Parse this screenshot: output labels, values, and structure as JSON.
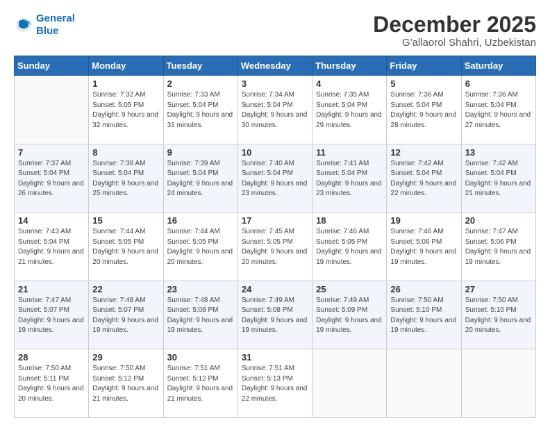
{
  "logo": {
    "line1": "General",
    "line2": "Blue"
  },
  "title": "December 2025",
  "location": "G'allaorol Shahri, Uzbekistan",
  "weekdays": [
    "Sunday",
    "Monday",
    "Tuesday",
    "Wednesday",
    "Thursday",
    "Friday",
    "Saturday"
  ],
  "weeks": [
    [
      {
        "day": "",
        "sunrise": "",
        "sunset": "",
        "daylight": ""
      },
      {
        "day": "1",
        "sunrise": "Sunrise: 7:32 AM",
        "sunset": "Sunset: 5:05 PM",
        "daylight": "Daylight: 9 hours and 32 minutes."
      },
      {
        "day": "2",
        "sunrise": "Sunrise: 7:33 AM",
        "sunset": "Sunset: 5:04 PM",
        "daylight": "Daylight: 9 hours and 31 minutes."
      },
      {
        "day": "3",
        "sunrise": "Sunrise: 7:34 AM",
        "sunset": "Sunset: 5:04 PM",
        "daylight": "Daylight: 9 hours and 30 minutes."
      },
      {
        "day": "4",
        "sunrise": "Sunrise: 7:35 AM",
        "sunset": "Sunset: 5:04 PM",
        "daylight": "Daylight: 9 hours and 29 minutes."
      },
      {
        "day": "5",
        "sunrise": "Sunrise: 7:36 AM",
        "sunset": "Sunset: 5:04 PM",
        "daylight": "Daylight: 9 hours and 28 minutes."
      },
      {
        "day": "6",
        "sunrise": "Sunrise: 7:36 AM",
        "sunset": "Sunset: 5:04 PM",
        "daylight": "Daylight: 9 hours and 27 minutes."
      }
    ],
    [
      {
        "day": "7",
        "sunrise": "Sunrise: 7:37 AM",
        "sunset": "Sunset: 5:04 PM",
        "daylight": "Daylight: 9 hours and 26 minutes."
      },
      {
        "day": "8",
        "sunrise": "Sunrise: 7:38 AM",
        "sunset": "Sunset: 5:04 PM",
        "daylight": "Daylight: 9 hours and 25 minutes."
      },
      {
        "day": "9",
        "sunrise": "Sunrise: 7:39 AM",
        "sunset": "Sunset: 5:04 PM",
        "daylight": "Daylight: 9 hours and 24 minutes."
      },
      {
        "day": "10",
        "sunrise": "Sunrise: 7:40 AM",
        "sunset": "Sunset: 5:04 PM",
        "daylight": "Daylight: 9 hours and 23 minutes."
      },
      {
        "day": "11",
        "sunrise": "Sunrise: 7:41 AM",
        "sunset": "Sunset: 5:04 PM",
        "daylight": "Daylight: 9 hours and 23 minutes."
      },
      {
        "day": "12",
        "sunrise": "Sunrise: 7:42 AM",
        "sunset": "Sunset: 5:04 PM",
        "daylight": "Daylight: 9 hours and 22 minutes."
      },
      {
        "day": "13",
        "sunrise": "Sunrise: 7:42 AM",
        "sunset": "Sunset: 5:04 PM",
        "daylight": "Daylight: 9 hours and 21 minutes."
      }
    ],
    [
      {
        "day": "14",
        "sunrise": "Sunrise: 7:43 AM",
        "sunset": "Sunset: 5:04 PM",
        "daylight": "Daylight: 9 hours and 21 minutes."
      },
      {
        "day": "15",
        "sunrise": "Sunrise: 7:44 AM",
        "sunset": "Sunset: 5:05 PM",
        "daylight": "Daylight: 9 hours and 20 minutes."
      },
      {
        "day": "16",
        "sunrise": "Sunrise: 7:44 AM",
        "sunset": "Sunset: 5:05 PM",
        "daylight": "Daylight: 9 hours and 20 minutes."
      },
      {
        "day": "17",
        "sunrise": "Sunrise: 7:45 AM",
        "sunset": "Sunset: 5:05 PM",
        "daylight": "Daylight: 9 hours and 20 minutes."
      },
      {
        "day": "18",
        "sunrise": "Sunrise: 7:46 AM",
        "sunset": "Sunset: 5:05 PM",
        "daylight": "Daylight: 9 hours and 19 minutes."
      },
      {
        "day": "19",
        "sunrise": "Sunrise: 7:46 AM",
        "sunset": "Sunset: 5:06 PM",
        "daylight": "Daylight: 9 hours and 19 minutes."
      },
      {
        "day": "20",
        "sunrise": "Sunrise: 7:47 AM",
        "sunset": "Sunset: 5:06 PM",
        "daylight": "Daylight: 9 hours and 19 minutes."
      }
    ],
    [
      {
        "day": "21",
        "sunrise": "Sunrise: 7:47 AM",
        "sunset": "Sunset: 5:07 PM",
        "daylight": "Daylight: 9 hours and 19 minutes."
      },
      {
        "day": "22",
        "sunrise": "Sunrise: 7:48 AM",
        "sunset": "Sunset: 5:07 PM",
        "daylight": "Daylight: 9 hours and 19 minutes."
      },
      {
        "day": "23",
        "sunrise": "Sunrise: 7:48 AM",
        "sunset": "Sunset: 5:08 PM",
        "daylight": "Daylight: 9 hours and 19 minutes."
      },
      {
        "day": "24",
        "sunrise": "Sunrise: 7:49 AM",
        "sunset": "Sunset: 5:08 PM",
        "daylight": "Daylight: 9 hours and 19 minutes."
      },
      {
        "day": "25",
        "sunrise": "Sunrise: 7:49 AM",
        "sunset": "Sunset: 5:09 PM",
        "daylight": "Daylight: 9 hours and 19 minutes."
      },
      {
        "day": "26",
        "sunrise": "Sunrise: 7:50 AM",
        "sunset": "Sunset: 5:10 PM",
        "daylight": "Daylight: 9 hours and 19 minutes."
      },
      {
        "day": "27",
        "sunrise": "Sunrise: 7:50 AM",
        "sunset": "Sunset: 5:10 PM",
        "daylight": "Daylight: 9 hours and 20 minutes."
      }
    ],
    [
      {
        "day": "28",
        "sunrise": "Sunrise: 7:50 AM",
        "sunset": "Sunset: 5:11 PM",
        "daylight": "Daylight: 9 hours and 20 minutes."
      },
      {
        "day": "29",
        "sunrise": "Sunrise: 7:50 AM",
        "sunset": "Sunset: 5:12 PM",
        "daylight": "Daylight: 9 hours and 21 minutes."
      },
      {
        "day": "30",
        "sunrise": "Sunrise: 7:51 AM",
        "sunset": "Sunset: 5:12 PM",
        "daylight": "Daylight: 9 hours and 21 minutes."
      },
      {
        "day": "31",
        "sunrise": "Sunrise: 7:51 AM",
        "sunset": "Sunset: 5:13 PM",
        "daylight": "Daylight: 9 hours and 22 minutes."
      },
      {
        "day": "",
        "sunrise": "",
        "sunset": "",
        "daylight": ""
      },
      {
        "day": "",
        "sunrise": "",
        "sunset": "",
        "daylight": ""
      },
      {
        "day": "",
        "sunrise": "",
        "sunset": "",
        "daylight": ""
      }
    ]
  ]
}
